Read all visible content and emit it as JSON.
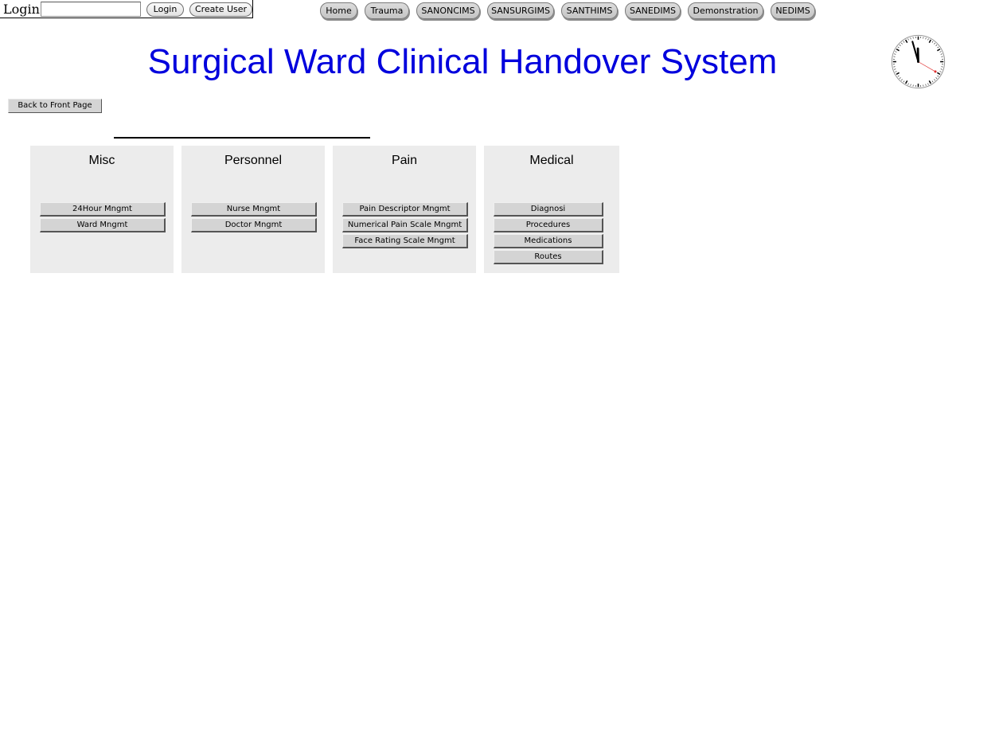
{
  "login": {
    "label": "Login:",
    "input_value": "",
    "login_button": "Login",
    "create_user_button": "Create User"
  },
  "topnav": [
    {
      "label": "Home"
    },
    {
      "label": "Trauma"
    },
    {
      "label": "SANONCIMS"
    },
    {
      "label": "SANSURGIMS"
    },
    {
      "label": "SANTHIMS"
    },
    {
      "label": "SANEDIMS"
    },
    {
      "label": "Demonstration"
    },
    {
      "label": "NEDIMS"
    }
  ],
  "header": {
    "title": "Surgical Ward Clinical Handover System"
  },
  "clock": {
    "icon": "analog-clock-icon",
    "hour": 11,
    "minute": 57,
    "second": 20
  },
  "back_button": "Back to Front Page",
  "panels": [
    {
      "title": "Misc",
      "buttons": [
        "24Hour Mngmt",
        "Ward Mngmt"
      ]
    },
    {
      "title": "Personnel",
      "buttons": [
        "Nurse Mngmt",
        "Doctor Mngmt"
      ]
    },
    {
      "title": "Pain",
      "buttons": [
        "Pain Descriptor Mngmt",
        "Numerical Pain Scale Mngmt",
        "Face Rating Scale Mngmt"
      ]
    },
    {
      "title": "Medical",
      "buttons": [
        "Diagnosi",
        "Procedures",
        "Medications",
        "Routes"
      ]
    }
  ],
  "colors": {
    "title": "#0000dd",
    "panel_bg": "#ececec",
    "button_bg": "#d4d4d4",
    "clock_second_hand": "#e03030"
  }
}
